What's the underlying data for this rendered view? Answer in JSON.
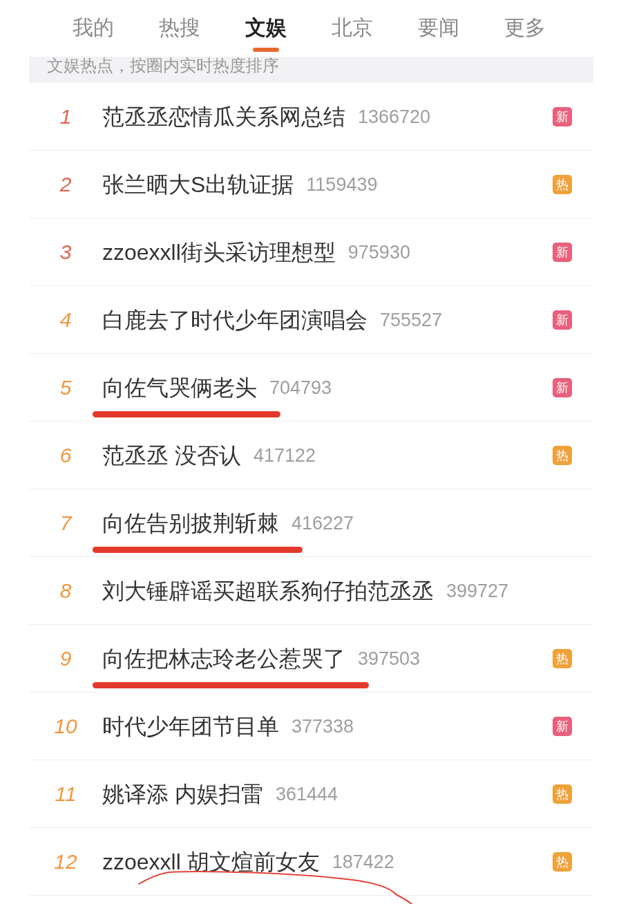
{
  "tabs": [
    {
      "label": "我的",
      "selected": false
    },
    {
      "label": "热搜",
      "selected": false
    },
    {
      "label": "文娱",
      "selected": true
    },
    {
      "label": "北京",
      "selected": false
    },
    {
      "label": "要闻",
      "selected": false
    },
    {
      "label": "更多",
      "selected": false
    }
  ],
  "subtitle": "文娱热点，按圈内实时热度排序",
  "items": [
    {
      "rank": "1",
      "color": "#e0654f",
      "title": "范丞丞恋情瓜关系网总结",
      "count": "1366720",
      "badge": {
        "label": "新",
        "color": "#e8607c"
      }
    },
    {
      "rank": "2",
      "color": "#e0654f",
      "title": "张兰晒大S出轨证据",
      "count": "1159439",
      "badge": {
        "label": "热",
        "color": "#f0a23a"
      }
    },
    {
      "rank": "3",
      "color": "#e0654f",
      "title": "zzoexxll街头采访理想型",
      "count": "975930",
      "badge": {
        "label": "新",
        "color": "#e8607c"
      }
    },
    {
      "rank": "4",
      "color": "#f0973e",
      "title": "白鹿去了时代少年团演唱会",
      "count": "755527",
      "badge": {
        "label": "新",
        "color": "#e8607c"
      }
    },
    {
      "rank": "5",
      "color": "#f0973e",
      "title": "向佐气哭俩老头",
      "count": "704793",
      "badge": {
        "label": "新",
        "color": "#e8607c"
      },
      "annotation": {
        "kind": "underline"
      }
    },
    {
      "rank": "6",
      "color": "#f0973e",
      "title": "范丞丞 没否认",
      "count": "417122",
      "badge": {
        "label": "热",
        "color": "#f0a23a"
      }
    },
    {
      "rank": "7",
      "color": "#f0973e",
      "title": "向佐告别披荆斩棘",
      "count": "416227",
      "annotation": {
        "kind": "underline"
      }
    },
    {
      "rank": "8",
      "color": "#f0973e",
      "title": "刘大锤辟谣买超联系狗仔拍范丞丞",
      "count": "399727"
    },
    {
      "rank": "9",
      "color": "#f0973e",
      "title": "向佐把林志玲老公惹哭了",
      "count": "397503",
      "badge": {
        "label": "热",
        "color": "#f0a23a"
      },
      "annotation": {
        "kind": "underline"
      }
    },
    {
      "rank": "10",
      "color": "#f0973e",
      "title": "时代少年团节目单",
      "count": "377338",
      "badge": {
        "label": "新",
        "color": "#e8607c"
      }
    },
    {
      "rank": "11",
      "color": "#f0973e",
      "title": "姚译添 内娱扫雷",
      "count": "361444",
      "badge": {
        "label": "热",
        "color": "#f0a23a"
      }
    },
    {
      "rank": "12",
      "color": "#f0973e",
      "title": "zzoexxll 胡文煊前女友",
      "count": "187422",
      "badge": {
        "label": "热",
        "color": "#f0a23a"
      },
      "annotation": {
        "kind": "curve"
      }
    }
  ]
}
